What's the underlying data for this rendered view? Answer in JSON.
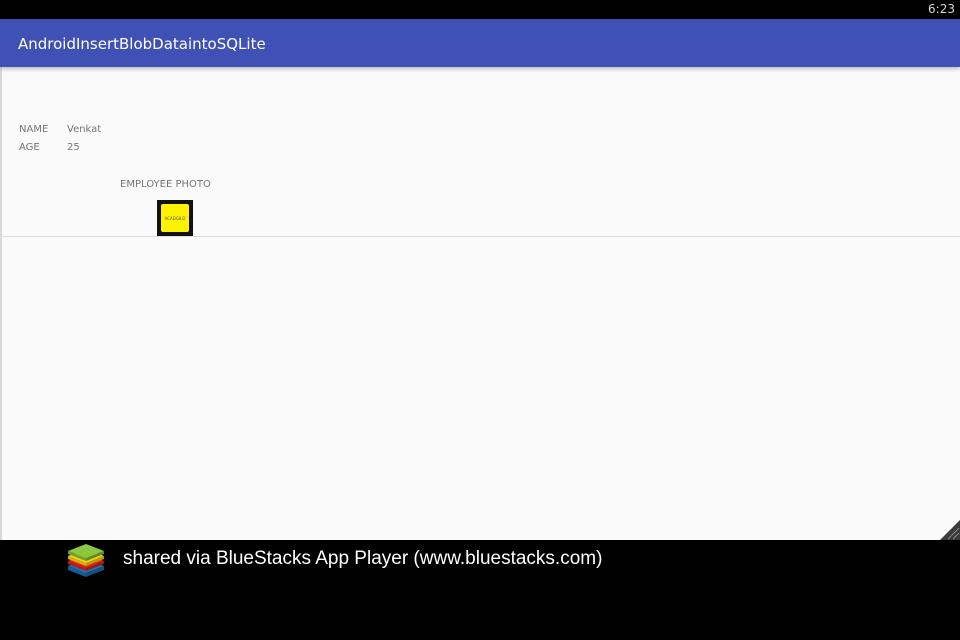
{
  "status_bar": {
    "time": "6:23"
  },
  "app_bar": {
    "title": "AndroidInsertBlobDataintoSQLite",
    "color": "#3f51b5"
  },
  "employee": {
    "name_label": "NAME",
    "name_value": "Venkat",
    "age_label": "AGE",
    "age_value": "25",
    "photo_label": "EMPLOYEE PHOTO",
    "photo_logo_text": "ACADGILD"
  },
  "footer": {
    "text": "shared via BlueStacks App Player (www.bluestacks.com)"
  },
  "colors": {
    "app_bar": "#3f51b5",
    "content_bg": "#fafafa",
    "photo_yellow": "#fff200",
    "logo_green": "#8dc63f",
    "logo_yellow": "#f7d117",
    "logo_red": "#e2231a",
    "logo_blue": "#1b75bc"
  }
}
